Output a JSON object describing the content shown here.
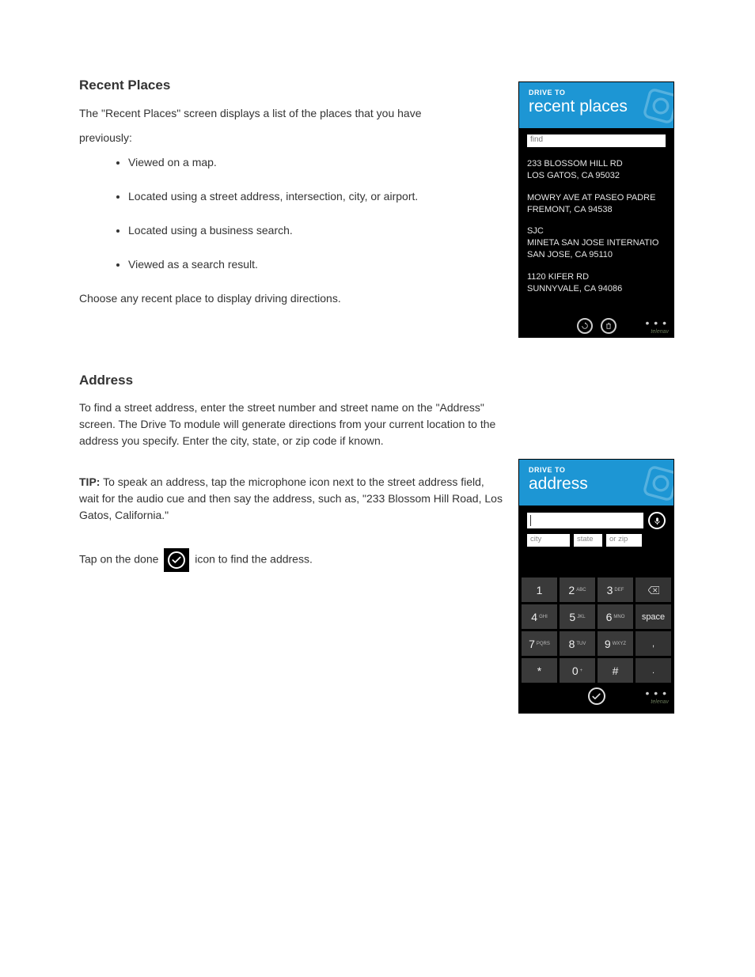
{
  "sections": {
    "recent": {
      "heading": "Recent Places",
      "intro1": "The \"Recent Places\" screen displays a list of the places that you have",
      "intro2": "previously:",
      "bullets": [
        "Viewed on a map.",
        "Located using a street address, intersection, city, or airport.",
        "Located using a business search.",
        "Viewed as a search result."
      ],
      "outro": "Choose any recent place to display driving directions."
    },
    "address": {
      "heading": "Address",
      "p1": "To find a street address, enter the street number and street name on the \"Address\" screen. The Drive To module will generate directions from your current location to the address you specify. Enter the city, state, or zip code if known.",
      "tip_bold": "TIP:",
      "tip_text": " To speak an address, tap the microphone icon next to the street address field, wait for the audio cue and then say the address, such as, \"233 Blossom Hill Road, Los Gatos, California.\"",
      "done_pre": "Tap on the done ",
      "done_post": " icon to find the address."
    }
  },
  "phone_recent": {
    "subtitle": "DRIVE TO",
    "title": "recent places",
    "find_placeholder": "find",
    "places": [
      {
        "l1": "233 BLOSSOM HILL RD",
        "l2": "LOS GATOS, CA 95032"
      },
      {
        "l1": "MOWRY AVE AT PASEO PADRE",
        "l2": "FREMONT, CA 94538"
      },
      {
        "l1": "SJC",
        "l2": "MINETA SAN JOSE INTERNATIO",
        "l3": "SAN JOSE, CA 95110"
      },
      {
        "l1": "1120 KIFER RD",
        "l2": "SUNNYVALE, CA 94086"
      }
    ],
    "brand": "telenav"
  },
  "phone_address": {
    "subtitle": "DRIVE TO",
    "title": "address",
    "placeholders": {
      "city": "city",
      "state": "state",
      "zip": "or zip"
    },
    "keypad": [
      [
        "1",
        ""
      ],
      [
        "2",
        "ABC"
      ],
      [
        "3",
        "DEF"
      ],
      [
        "backspace",
        ""
      ],
      [
        "4",
        "GHI"
      ],
      [
        "5",
        "JKL"
      ],
      [
        "6",
        "MNO"
      ],
      [
        "space",
        ""
      ],
      [
        "7",
        "PQRS"
      ],
      [
        "8",
        "TUV"
      ],
      [
        "9",
        "WXYZ"
      ],
      [
        ",",
        ""
      ],
      [
        "*",
        ""
      ],
      [
        "0",
        "+"
      ],
      [
        "#",
        ""
      ],
      [
        ".",
        ""
      ]
    ],
    "brand": "telenav"
  }
}
